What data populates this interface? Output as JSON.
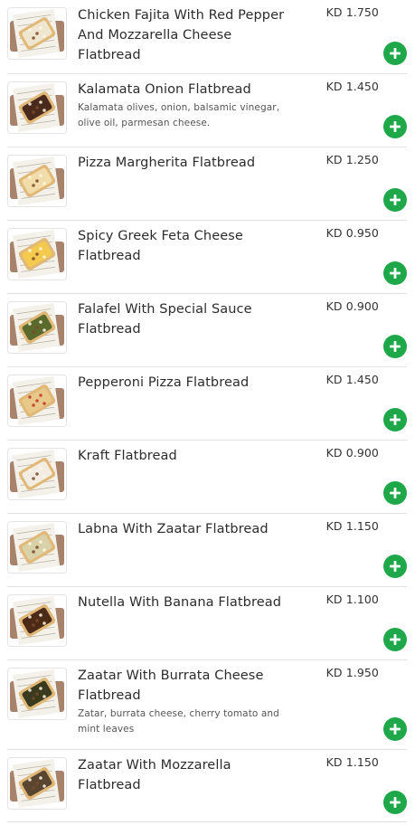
{
  "items": [
    {
      "name": "Chicken Fajita With Red Pepper And Mozzarella Cheese Flatbread",
      "description": "",
      "price": "KD 1.750",
      "image_icon": "flatbread-image",
      "topping_color": "#efe6d0"
    },
    {
      "name": "Kalamata Onion Flatbread",
      "description": "Kalamata olives, onion, balsamic vinegar, olive oil, parmesan cheese.",
      "price": "KD 1.450",
      "image_icon": "flatbread-image",
      "topping_color": "#4a2a1c"
    },
    {
      "name": "Pizza Margherita Flatbread",
      "description": "",
      "price": "KD 1.250",
      "image_icon": "flatbread-image",
      "topping_color": "#f1dcaa"
    },
    {
      "name": "Spicy Greek Feta Cheese Flatbread",
      "description": "",
      "price": "KD 0.950",
      "image_icon": "flatbread-image",
      "topping_color": "#f3c94e"
    },
    {
      "name": "Falafel With Special Sauce Flatbread",
      "description": "",
      "price": "KD 0.900",
      "image_icon": "flatbread-image",
      "topping_color": "#5a6a2c"
    },
    {
      "name": "Pepperoni Pizza Flatbread",
      "description": "",
      "price": "KD 1.450",
      "image_icon": "flatbread-image",
      "topping_color": "#e8c98a"
    },
    {
      "name": "Kraft Flatbread",
      "description": "",
      "price": "KD 0.900",
      "image_icon": "flatbread-image",
      "topping_color": "#f2ece2"
    },
    {
      "name": "Labna With Zaatar Flatbread",
      "description": "",
      "price": "KD 1.150",
      "image_icon": "flatbread-image",
      "topping_color": "#d9d2a8"
    },
    {
      "name": "Nutella With Banana Flatbread",
      "description": "",
      "price": "KD 1.100",
      "image_icon": "flatbread-image",
      "topping_color": "#4b2a18"
    },
    {
      "name": "Zaatar With Burrata Cheese Flatbread",
      "description": "Zatar, burrata cheese, cherry tomato and mint leaves",
      "price": "KD 1.950",
      "image_icon": "flatbread-image",
      "topping_color": "#3a3a1e"
    },
    {
      "name": "Zaatar With Mozzarella Flatbread",
      "description": "",
      "price": "KD 1.150",
      "image_icon": "flatbread-image",
      "topping_color": "#5a4630"
    }
  ],
  "add_button_icon": "plus-icon",
  "accent_color": "#1fa84a"
}
